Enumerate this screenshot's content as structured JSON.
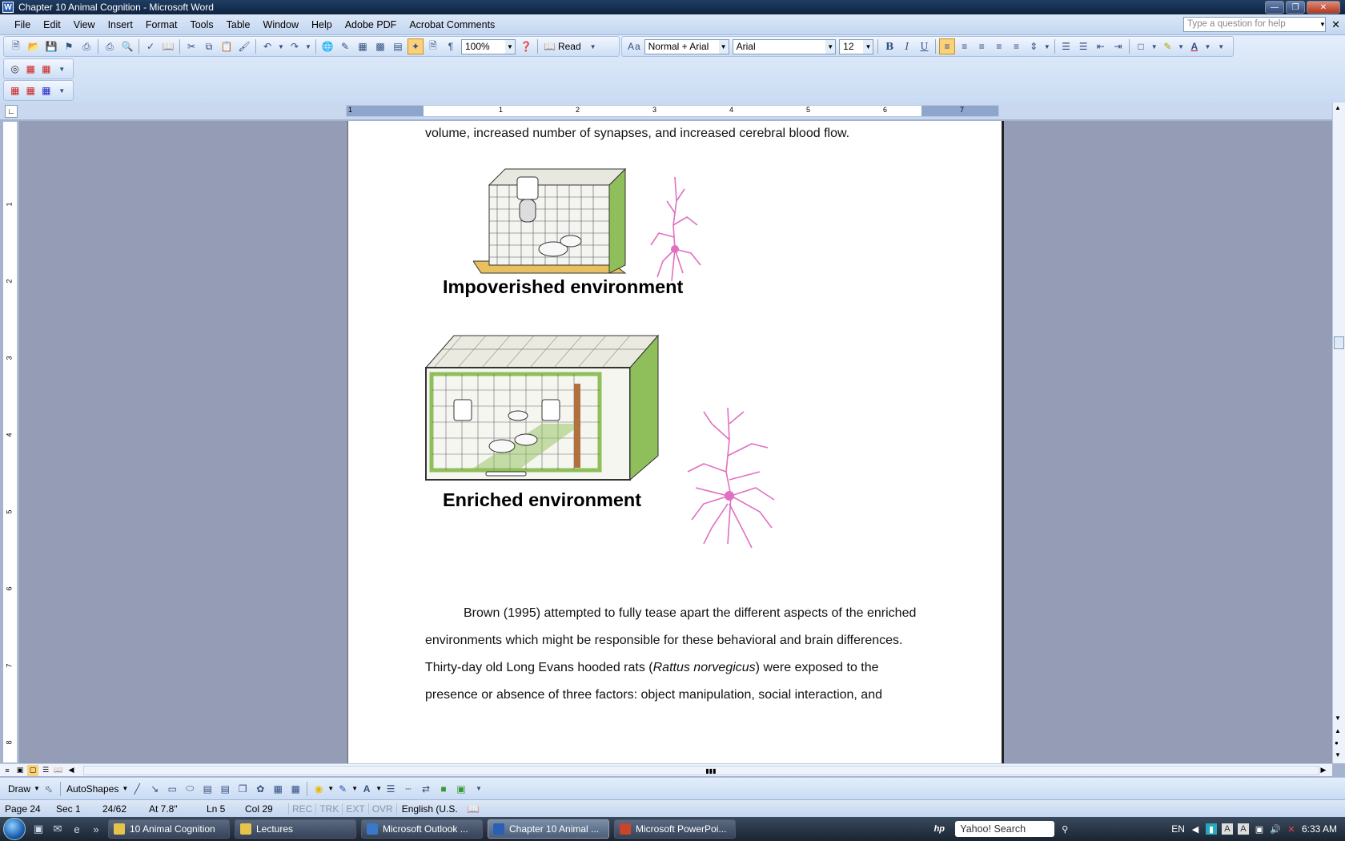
{
  "window": {
    "title": "Chapter 10 Animal Cognition - Microsoft Word"
  },
  "menu": {
    "items": [
      "File",
      "Edit",
      "View",
      "Insert",
      "Format",
      "Tools",
      "Table",
      "Window",
      "Help",
      "Adobe PDF",
      "Acrobat Comments"
    ],
    "help_placeholder": "Type a question for help"
  },
  "toolbar": {
    "zoom": "100%",
    "read_label": "Read",
    "style": "Normal + Arial",
    "font": "Arial",
    "size": "12",
    "bold": "B",
    "italic": "I",
    "underline": "U",
    "paragraph_mark": "¶"
  },
  "ruler": {
    "marks": [
      "1",
      "1",
      "2",
      "3",
      "4",
      "5",
      "6",
      "7"
    ]
  },
  "vruler": {
    "marks": [
      "1",
      "2",
      "3",
      "4",
      "5",
      "6",
      "7",
      "8"
    ]
  },
  "document": {
    "line_top": "volume, increased number of synapses, and increased cerebral blood flow.",
    "caption_1": "Impoverished environment",
    "caption_2": "Enriched environment",
    "para_line_1": "Brown (1995) attempted to fully tease apart the different aspects of the enriched",
    "para_line_2": "environments which might be responsible for these behavioral and brain differences.",
    "para_line_3_a": "Thirty-day old Long Evans hooded rats (",
    "para_line_3_italic": "Rattus norvegicus",
    "para_line_3_b": ") were exposed to the",
    "para_line_4": "presence or absence of three factors: object manipulation, social interaction, and"
  },
  "drawing_toolbar": {
    "draw": "Draw",
    "autoshapes": "AutoShapes"
  },
  "status": {
    "page": "Page 24",
    "sec": "Sec 1",
    "pages": "24/62",
    "at": "At 7.8\"",
    "ln": "Ln 5",
    "col": "Col 29",
    "rec": "REC",
    "trk": "TRK",
    "ext": "EXT",
    "ovr": "OVR",
    "language": "English (U.S."
  },
  "taskbar": {
    "tasks": [
      {
        "label": "10 Animal Cognition",
        "color": "#e6c34a"
      },
      {
        "label": "Lectures",
        "color": "#e6c34a"
      },
      {
        "label": "Microsoft Outlook ...",
        "color": "#3a78c8"
      },
      {
        "label": "Chapter 10 Animal ...",
        "color": "#2b5fb4"
      },
      {
        "label": "Microsoft PowerPoi...",
        "color": "#c8442a"
      }
    ],
    "search": "Yahoo! Search",
    "language": "EN",
    "clock": "6:33 AM"
  },
  "colors": {
    "accent": "#2b5fb4",
    "neuron": "#e070c0",
    "cage_green": "#8fbf5a",
    "cage_floor": "#e8c060"
  }
}
